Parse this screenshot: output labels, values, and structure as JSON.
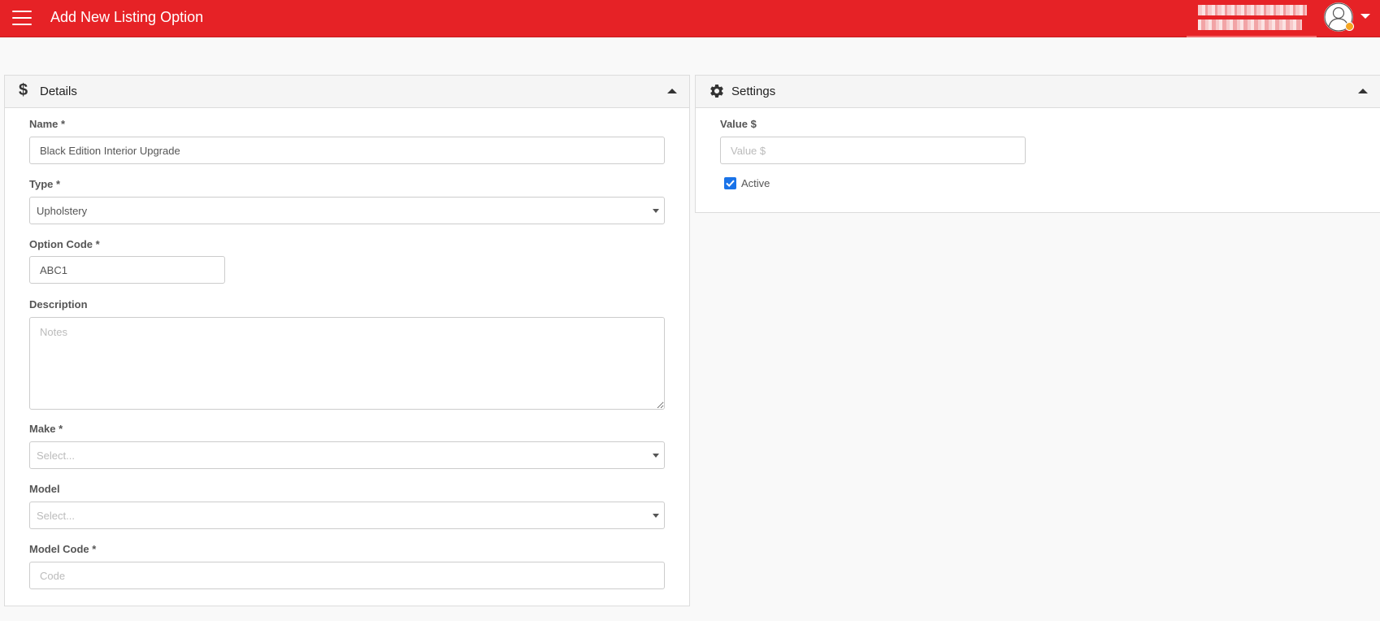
{
  "header": {
    "title": "Add New Listing Option",
    "menu_icon": "hamburger-menu-icon",
    "user_icon": "user-avatar-icon",
    "user_name": "",
    "user_email": ""
  },
  "details": {
    "title": "Details",
    "icon": "dollar-icon",
    "fields": {
      "name": {
        "label": "Name *",
        "value": "Black Edition Interior Upgrade"
      },
      "type": {
        "label": "Type *",
        "value": "Upholstery"
      },
      "option_code": {
        "label": "Option Code *",
        "value": "ABC1"
      },
      "description": {
        "label": "Description",
        "placeholder": "Notes"
      },
      "make": {
        "label": "Make *",
        "placeholder": "Select..."
      },
      "model": {
        "label": "Model",
        "placeholder": "Select..."
      },
      "model_code": {
        "label": "Model Code *",
        "placeholder": "Code"
      }
    }
  },
  "settings": {
    "title": "Settings",
    "icon": "gear-icon",
    "value_field": {
      "label": "Value $",
      "placeholder": "Value $"
    },
    "active": {
      "label": "Active",
      "checked": true
    }
  },
  "colors": {
    "header_bg": "#e62226",
    "accent": "#1a73e8",
    "status_dot": "#f5a623"
  }
}
